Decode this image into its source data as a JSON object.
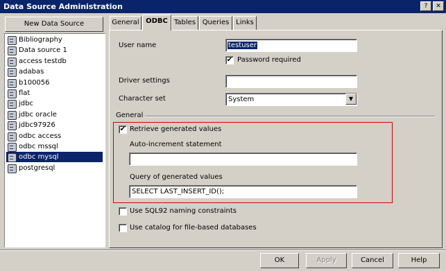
{
  "window": {
    "title": "Data Source Administration",
    "close_symbol": "✕",
    "help_symbol": "?"
  },
  "sidebar": {
    "new_button": "New Data Source",
    "items": [
      {
        "label": "Bibliography",
        "selected": false
      },
      {
        "label": "Data source 1",
        "selected": false
      },
      {
        "label": "access testdb",
        "selected": false
      },
      {
        "label": "adabas",
        "selected": false
      },
      {
        "label": "b100056",
        "selected": false
      },
      {
        "label": "flat",
        "selected": false
      },
      {
        "label": "jdbc",
        "selected": false
      },
      {
        "label": "jdbc oracle",
        "selected": false
      },
      {
        "label": "jdbc97926",
        "selected": false
      },
      {
        "label": "odbc access",
        "selected": false
      },
      {
        "label": "odbc mssql",
        "selected": false
      },
      {
        "label": "odbc mysql",
        "selected": true
      },
      {
        "label": "postgresql",
        "selected": false
      }
    ]
  },
  "tabs": [
    {
      "label": "General",
      "active": false
    },
    {
      "label": "ODBC",
      "active": true
    },
    {
      "label": "Tables",
      "active": false
    },
    {
      "label": "Queries",
      "active": false
    },
    {
      "label": "Links",
      "active": false
    }
  ],
  "form": {
    "user_name_label": "User name",
    "user_name_value": "testuser",
    "password_required_label": "Password required",
    "password_required_checked": true,
    "driver_settings_label": "Driver settings",
    "driver_settings_value": "",
    "character_set_label": "Character set",
    "character_set_value": "System",
    "dropdown_arrow": "▼"
  },
  "general": {
    "group_label": "General",
    "retrieve_label": "Retrieve generated values",
    "retrieve_checked": true,
    "auto_increment_label": "Auto-increment statement",
    "auto_increment_value": "",
    "query_label": "Query of generated values",
    "query_value": "SELECT LAST_INSERT_ID();",
    "sql92_label": "Use SQL92 naming constraints",
    "sql92_checked": false,
    "catalog_label": "Use catalog for file-based databases",
    "catalog_checked": false
  },
  "footer": {
    "ok": "OK",
    "apply": "Apply",
    "cancel": "Cancel",
    "help": "Help"
  },
  "check_mark": "✔"
}
